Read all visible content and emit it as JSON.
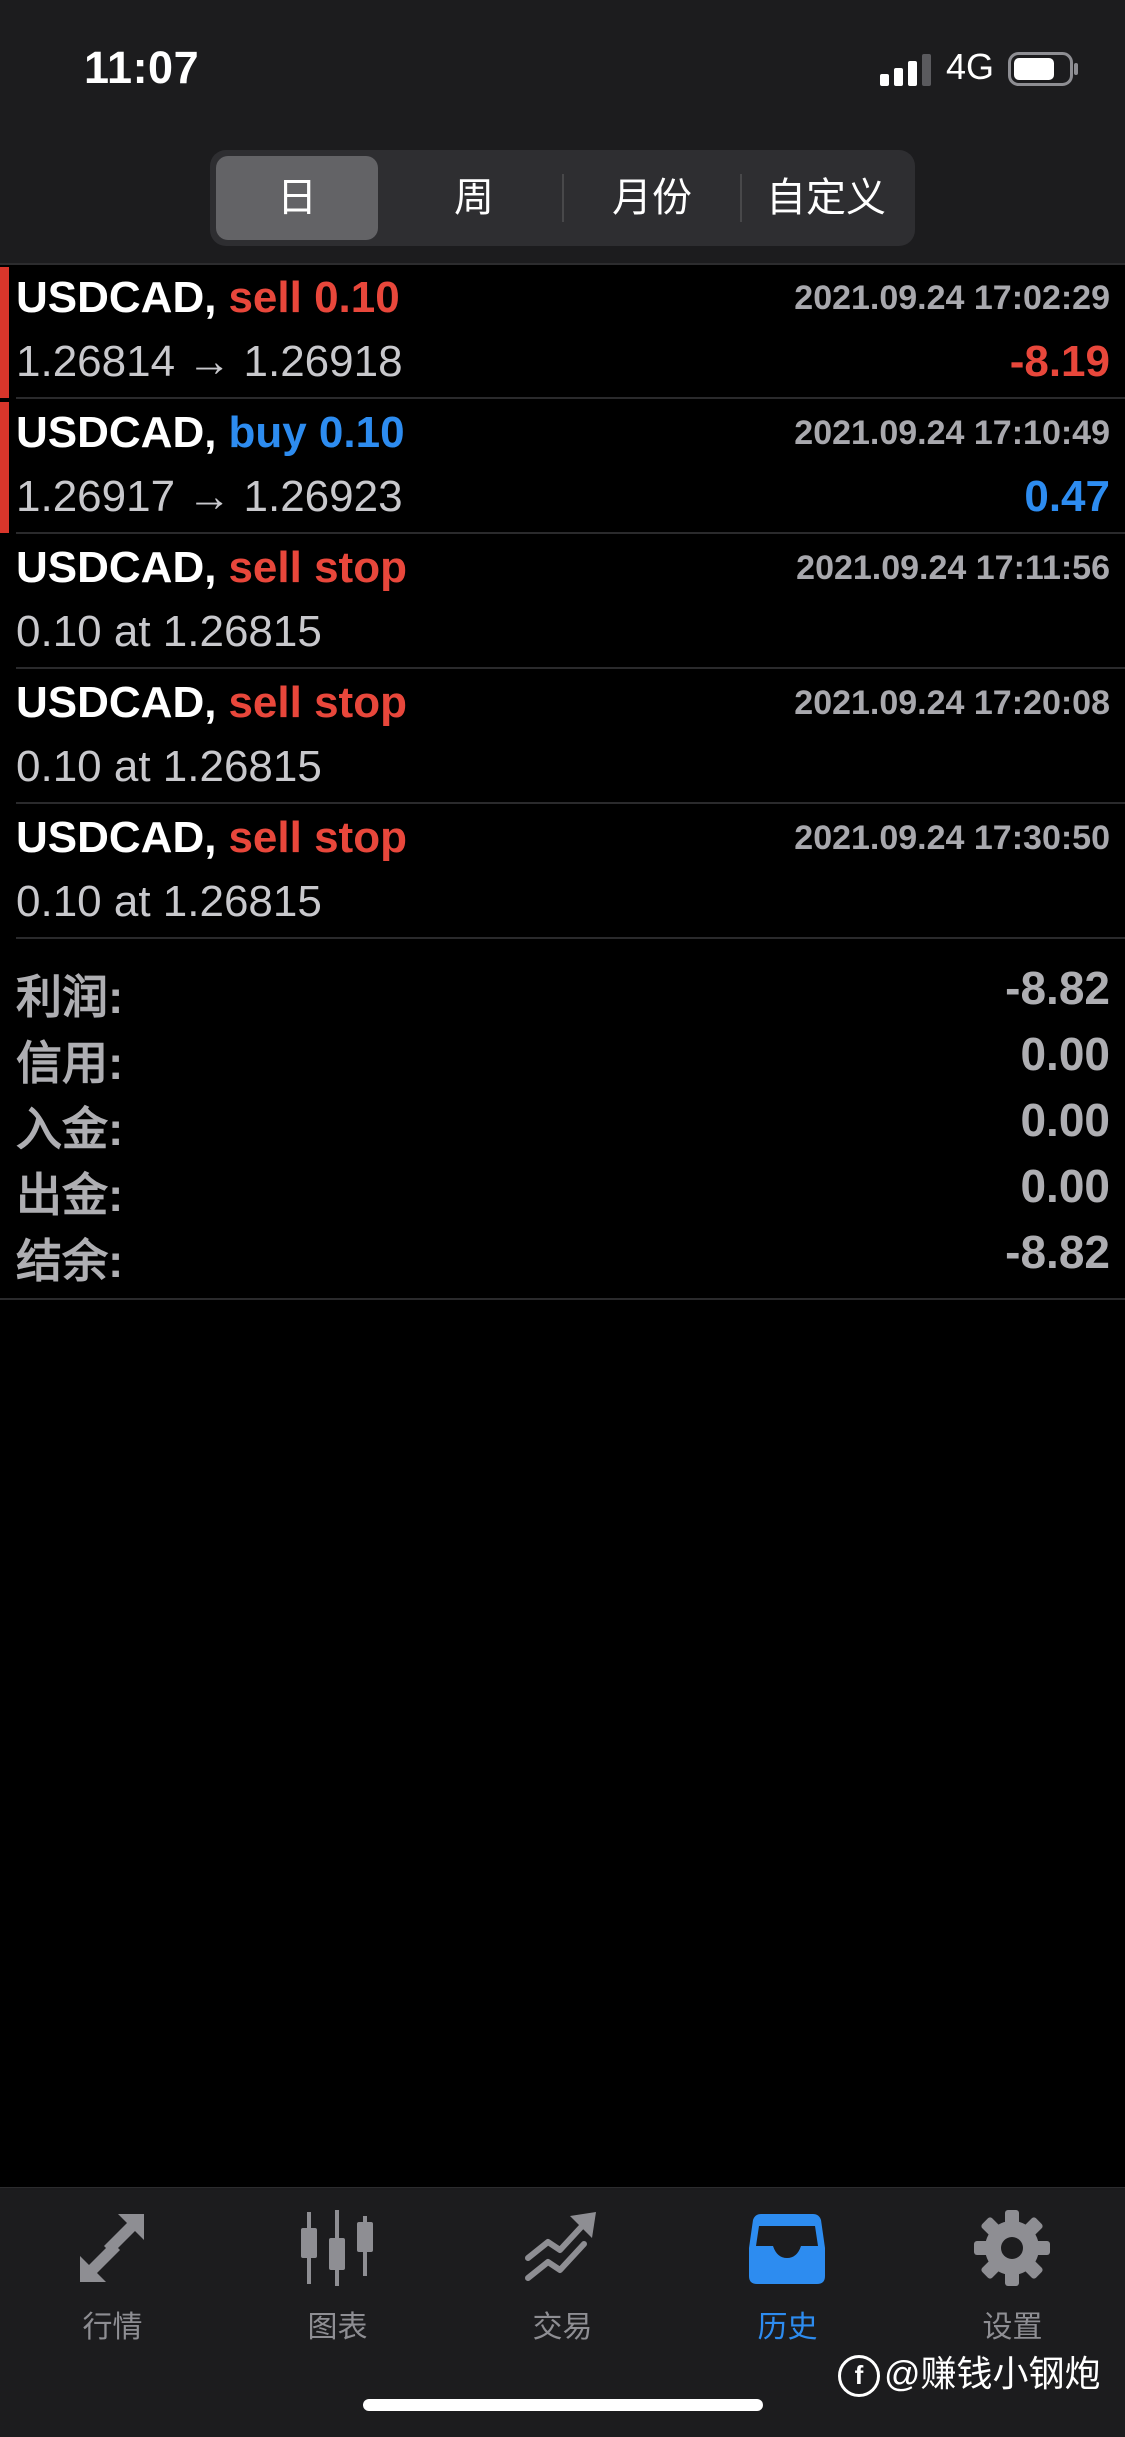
{
  "status_bar": {
    "time": "11:07",
    "network": "4G"
  },
  "period_tabs": [
    {
      "label": "日",
      "selected": true
    },
    {
      "label": "周",
      "selected": false
    },
    {
      "label": "月份",
      "selected": false
    },
    {
      "label": "自定义",
      "selected": false
    }
  ],
  "history": [
    {
      "symbol": "USDCAD,",
      "action": "sell 0.10",
      "action_color": "red",
      "timestamp": "2021.09.24 17:02:29",
      "detail": "1.26814 → 1.26918",
      "profit": "-8.19",
      "profit_color": "red",
      "marker": true
    },
    {
      "symbol": "USDCAD,",
      "action": "buy 0.10",
      "action_color": "blue",
      "timestamp": "2021.09.24 17:10:49",
      "detail": "1.26917 → 1.26923",
      "profit": "0.47",
      "profit_color": "blue",
      "marker": true
    },
    {
      "symbol": "USDCAD,",
      "action": "sell stop",
      "action_color": "red",
      "timestamp": "2021.09.24 17:11:56",
      "detail": "0.10 at 1.26815",
      "profit": "",
      "marker": false
    },
    {
      "symbol": "USDCAD,",
      "action": "sell stop",
      "action_color": "red",
      "timestamp": "2021.09.24 17:20:08",
      "detail": "0.10 at 1.26815",
      "profit": "",
      "marker": false
    },
    {
      "symbol": "USDCAD,",
      "action": "sell stop",
      "action_color": "red",
      "timestamp": "2021.09.24 17:30:50",
      "detail": "0.10 at 1.26815",
      "profit": "",
      "marker": false
    }
  ],
  "summary": [
    {
      "label": "利润:",
      "value": "-8.82"
    },
    {
      "label": "信用:",
      "value": "0.00"
    },
    {
      "label": "入金:",
      "value": "0.00"
    },
    {
      "label": "出金:",
      "value": "0.00"
    },
    {
      "label": "结余:",
      "value": "-8.82"
    }
  ],
  "tab_bar": [
    {
      "label": "行情",
      "icon": "quotes-arrows-icon",
      "active": false
    },
    {
      "label": "图表",
      "icon": "candlestick-chart-icon",
      "active": false
    },
    {
      "label": "交易",
      "icon": "trade-trend-icon",
      "active": false
    },
    {
      "label": "历史",
      "icon": "history-inbox-icon",
      "active": true
    },
    {
      "label": "设置",
      "icon": "gear-icon",
      "active": false
    }
  ],
  "watermark": {
    "text": "@赚钱小钢炮",
    "logo": "f"
  },
  "colors": {
    "sell": "#e8473b",
    "buy": "#2d8cf0",
    "active_tab": "#2d8cf0",
    "marker": "#d9362b"
  }
}
